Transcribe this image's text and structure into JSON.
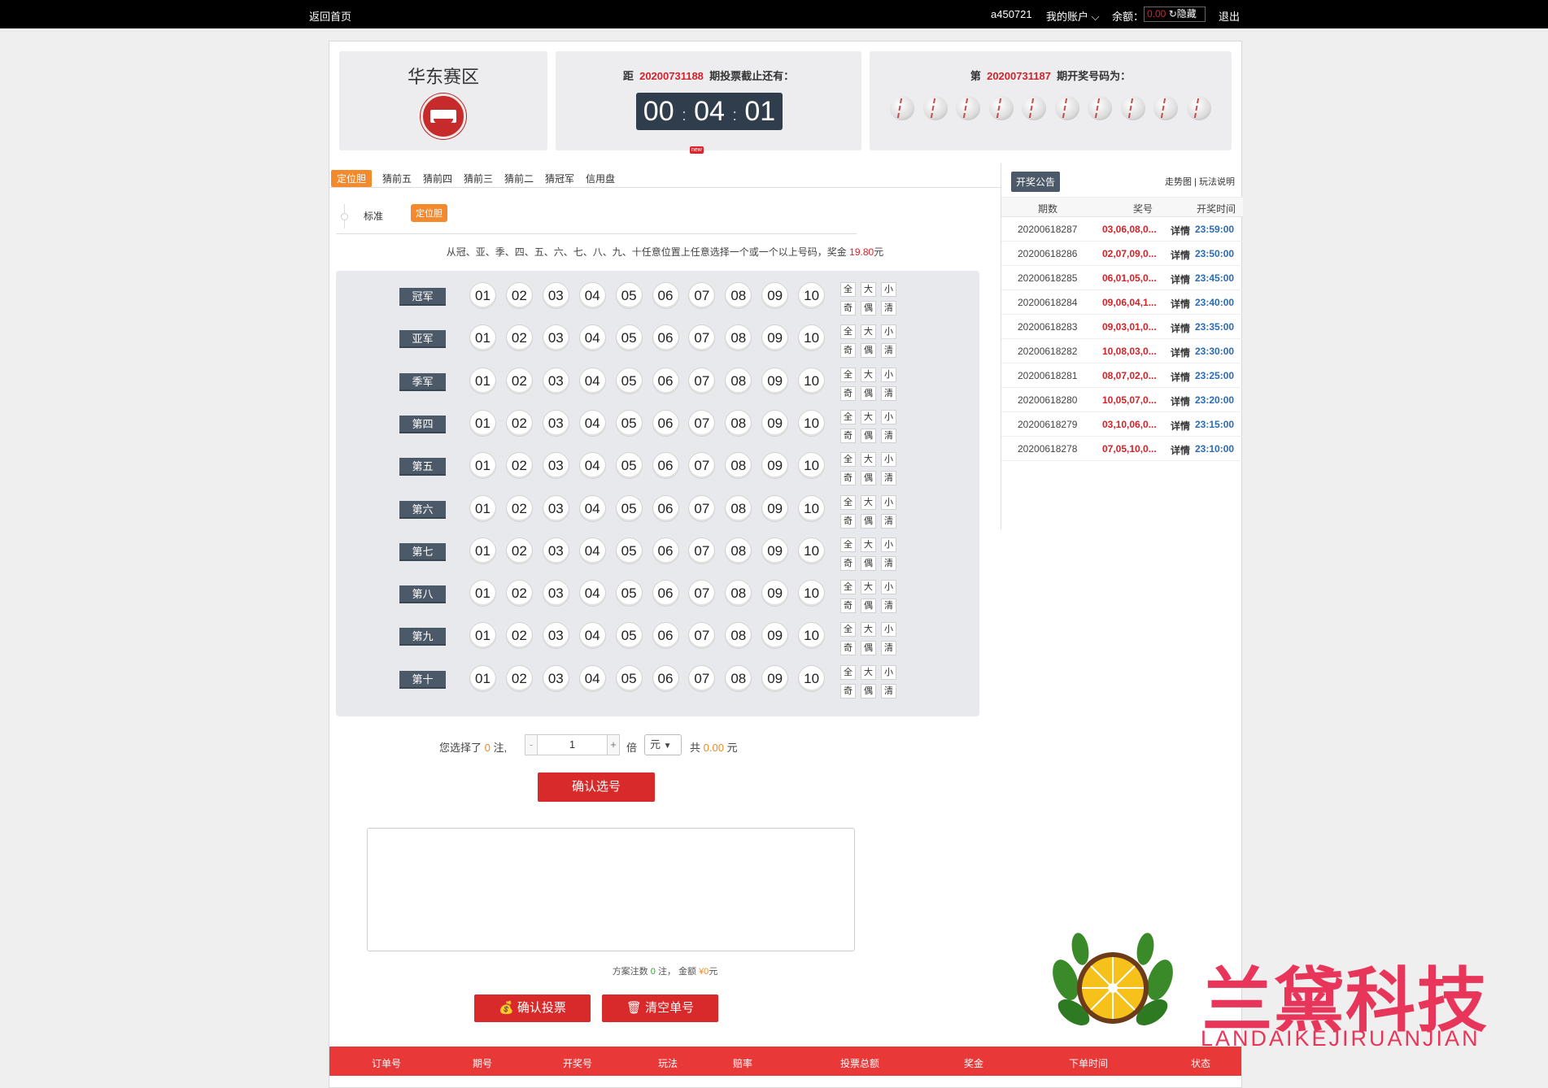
{
  "topbar": {
    "home": "返回首页",
    "user": "a450721",
    "account": "我的账户",
    "balance_label": "余额：",
    "balance_value": "0.00",
    "hide": "隐藏",
    "logout": "退出"
  },
  "region": {
    "name": "华东赛区"
  },
  "countdown": {
    "prefix": "距",
    "issue": "20200731188",
    "suffix": "期投票截止还有：",
    "h": "00",
    "m": "04",
    "s": "01",
    "new_tag": "new"
  },
  "last_draw": {
    "prefix": "第",
    "issue": "20200731187",
    "suffix": "期开奖号码为：",
    "ball_count": 10
  },
  "tabs": [
    "定位胆",
    "猜前五",
    "猜前四",
    "猜前三",
    "猜前二",
    "猜冠军",
    "信用盘"
  ],
  "subtabs": {
    "standard": "标准",
    "active": "定位胆"
  },
  "rule": {
    "text": "从冠、亚、季、四、五、六、七、八、九、十任意位置上任意选择一个或一个以上号码，奖金",
    "prize": "19.80",
    "unit": "元"
  },
  "positions": [
    "冠军",
    "亚军",
    "季军",
    "第四",
    "第五",
    "第六",
    "第七",
    "第八",
    "第九",
    "第十"
  ],
  "numbers": [
    "01",
    "02",
    "03",
    "04",
    "05",
    "06",
    "07",
    "08",
    "09",
    "10"
  ],
  "quick": [
    "全",
    "大",
    "小",
    "奇",
    "偶",
    "清"
  ],
  "bet": {
    "selected_prefix": "您选择了",
    "selected_count": "0",
    "selected_suffix": "注,",
    "minus": "-",
    "multiplier": "1",
    "plus": "+",
    "bei": "倍",
    "unit": "元",
    "total_prefix": "共",
    "total": "0.00",
    "total_suffix": "元"
  },
  "buttons": {
    "confirm_select": "确认选号",
    "submit": "确认投票",
    "clear": "清空单号"
  },
  "summary": {
    "prefix": "方案注数",
    "count": "0",
    "mid": "注，  金额",
    "amount": "¥0",
    "suffix": "元"
  },
  "orders_header": [
    "订单号",
    "期号",
    "开奖号",
    "玩法",
    "赔率",
    "投票总额",
    "奖金",
    "下单时间",
    "状态"
  ],
  "history": {
    "title": "开奖公告",
    "links": "走势图 | 玩法说明",
    "columns": [
      "期数",
      "奖号",
      "开奖时间"
    ],
    "rows": [
      {
        "period": "20200618287",
        "code": "03,06,08,0...",
        "detail": "详情",
        "time": "23:59:00"
      },
      {
        "period": "20200618286",
        "code": "02,07,09,0...",
        "detail": "详情",
        "time": "23:50:00"
      },
      {
        "period": "20200618285",
        "code": "06,01,05,0...",
        "detail": "详情",
        "time": "23:45:00"
      },
      {
        "period": "20200618284",
        "code": "09,06,04,1...",
        "detail": "详情",
        "time": "23:40:00"
      },
      {
        "period": "20200618283",
        "code": "09,03,01,0...",
        "detail": "详情",
        "time": "23:35:00"
      },
      {
        "period": "20200618282",
        "code": "10,08,03,0...",
        "detail": "详情",
        "time": "23:30:00"
      },
      {
        "period": "20200618281",
        "code": "08,07,02,0...",
        "detail": "详情",
        "time": "23:25:00"
      },
      {
        "period": "20200618280",
        "code": "10,05,07,0...",
        "detail": "详情",
        "time": "23:20:00"
      },
      {
        "period": "20200618279",
        "code": "03,10,06,0...",
        "detail": "详情",
        "time": "23:15:00"
      },
      {
        "period": "20200618278",
        "code": "07,05,10,0...",
        "detail": "详情",
        "time": "23:10:00"
      }
    ]
  },
  "brand": {
    "name": "兰黛科技",
    "sub": "LANDAIKEJIRUANJIAN"
  },
  "colors": {
    "accent_orange": "#f58a2c",
    "red": "#d82a2a",
    "navy": "#4c5968",
    "blue": "#2a6bb5"
  }
}
